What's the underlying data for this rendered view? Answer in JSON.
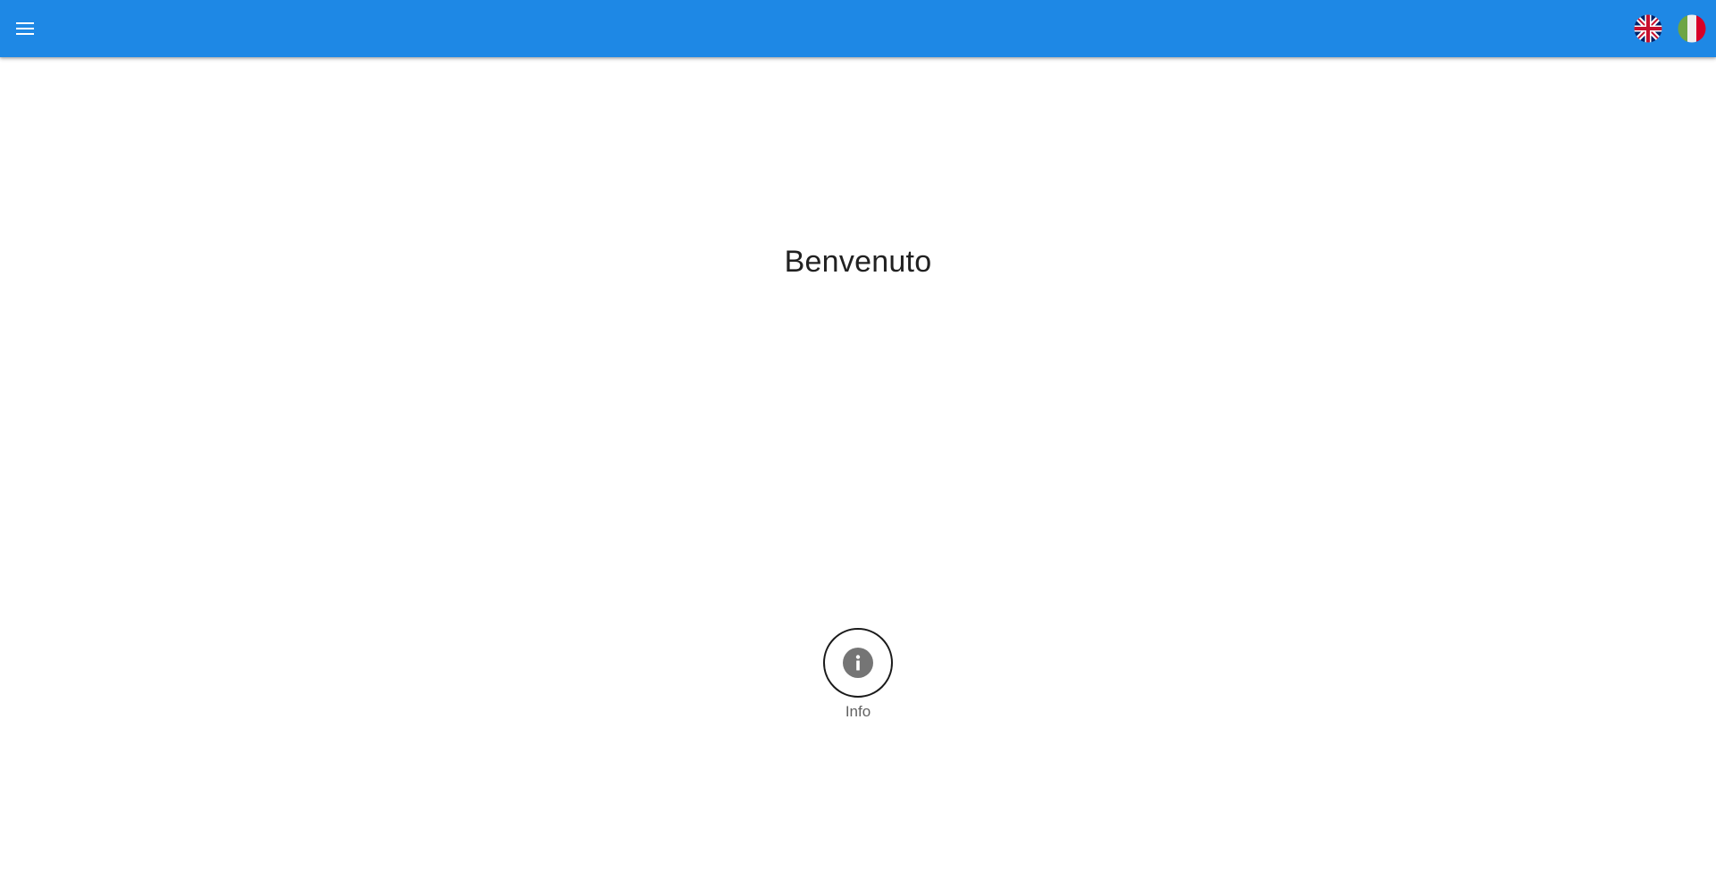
{
  "header": {
    "menu_icon": "menu-icon",
    "bar_color": "#1e88e5",
    "languages": [
      {
        "code": "en",
        "icon": "uk-flag-icon"
      },
      {
        "code": "it",
        "icon": "italy-flag-icon"
      }
    ]
  },
  "main": {
    "title": "Benvenuto",
    "tiles": [
      {
        "label": "Info",
        "icon": "info-icon"
      }
    ]
  }
}
